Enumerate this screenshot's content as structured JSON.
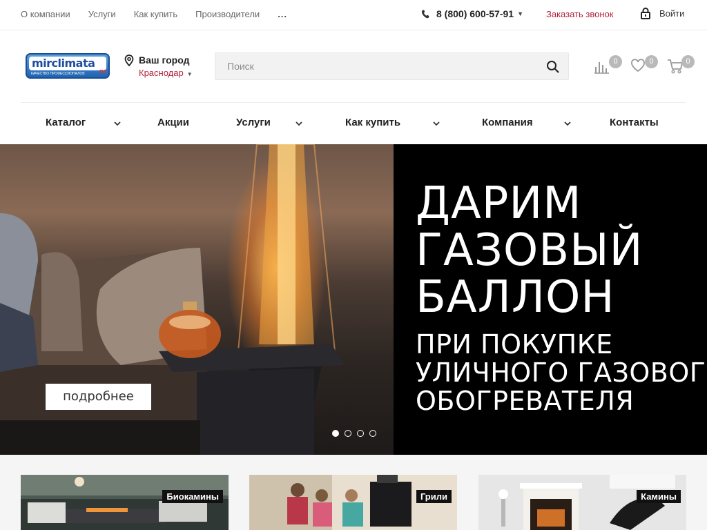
{
  "topbar": {
    "links": [
      "О компании",
      "Услуги",
      "Как купить",
      "Производители",
      "..."
    ],
    "phone": "8 (800) 600-57-91",
    "callback": "Заказать звонок",
    "login": "Войти"
  },
  "header": {
    "logo_text": "mirclimata",
    "logo_domain": ".ru",
    "logo_tagline": "КАЧЕСТВО ПРОФЕССИОНАЛОВ",
    "city_label": "Ваш город",
    "city_name": "Краснодар",
    "search_placeholder": "Поиск",
    "compare_count": "0",
    "favorites_count": "0",
    "cart_count": "0"
  },
  "nav": {
    "items": [
      "Каталог",
      "Акции",
      "Услуги",
      "Как купить",
      "Компания",
      "Контакты"
    ]
  },
  "banner": {
    "title_lines": [
      "ДАРИМ",
      "ГАЗОВЫЙ",
      "БАЛЛОН"
    ],
    "subtitle_lines": [
      "ПРИ ПОКУПКЕ",
      "УЛИЧНОГО ГАЗОВОГО",
      "ОБОГРЕВАТЕЛЯ"
    ],
    "button": "подробнее",
    "slide_count": 4,
    "active_slide": 1
  },
  "categories": [
    "Биокамины",
    "Грили",
    "Камины"
  ]
}
